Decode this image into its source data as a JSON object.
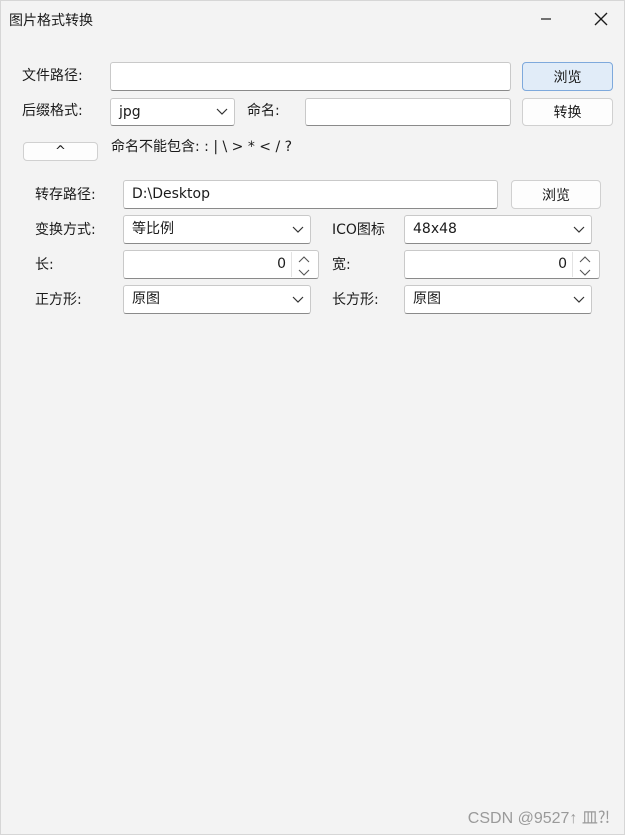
{
  "window": {
    "title": "图片格式转换"
  },
  "form": {
    "file_path_label": "文件路径:",
    "file_path_value": "",
    "browse1_label": "浏览",
    "suffix_label": "后缀格式:",
    "suffix_value": "jpg",
    "name_label": "命名:",
    "name_value": "",
    "convert_label": "转换",
    "collapse_label": "^",
    "naming_rule": "命名不能包含: : | \\  > * < / ?",
    "save_path_label": "转存路径:",
    "save_path_value": "D:\\Desktop",
    "browse2_label": "浏览",
    "mode_label": "变换方式:",
    "mode_value": "等比例",
    "ico_label": "ICO图标",
    "ico_value": "48x48",
    "length_label": "长:",
    "length_value": "0",
    "width_label": "宽:",
    "width_value": "0",
    "square_label": "正方形:",
    "square_value": "原图",
    "rect_label": "长方形:",
    "rect_value": "原图"
  },
  "watermark": "CSDN @9527↑ 皿⁈"
}
